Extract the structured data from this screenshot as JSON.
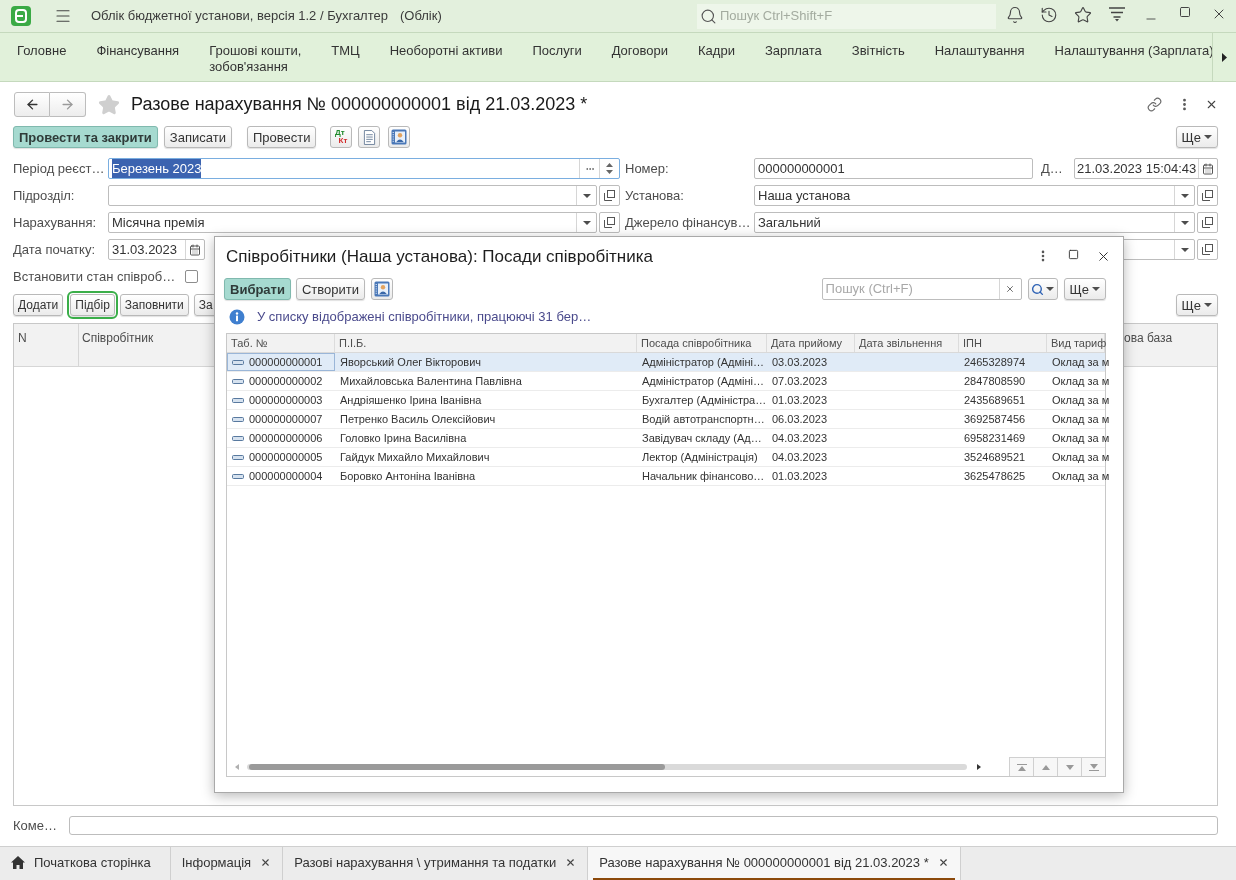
{
  "app_bar": {
    "title": "Облік бюджетної установи, версія 1.2 / Бухгалтер",
    "mode": "(Облік)",
    "search": {
      "placeholder": "Пошук Ctrl+Shift+F"
    }
  },
  "sections": [
    "Головне",
    "Фінансування",
    "Грошові кошти,\nзобов'язання",
    "ТМЦ",
    "Необоротні активи",
    "Послуги",
    "Договори",
    "Кадри",
    "Зарплата",
    "Звітність",
    "Налаштування",
    "Налаштування (Зарплата)"
  ],
  "document": {
    "title": "Разове нарахування № 000000000001 від 21.03.2023 *",
    "toolbar": [
      {
        "kind": "primary",
        "label": "Провести та закрити"
      },
      {
        "kind": "text",
        "label": "Записати"
      },
      {
        "kind": "text",
        "label": "Провести"
      },
      {
        "kind": "debit_credit",
        "top": "Дт",
        "bottom": "Кт"
      },
      {
        "kind": "report"
      },
      {
        "kind": "employee"
      }
    ],
    "more": "Ще",
    "fields_left": [
      {
        "kind": "period",
        "label": "Період реєст…",
        "value": "Березень 2023",
        "focused": true
      },
      {
        "kind": "select",
        "label": "Підрозділ:",
        "focused": false
      },
      {
        "kind": "select",
        "label": "Нарахування:",
        "value": "Місячна премія",
        "focused": false
      },
      {
        "kind": "date",
        "label": "Дата початку:",
        "value": "31.03.2023",
        "focused": false
      },
      {
        "kind": "checkbox",
        "label": "Встановити стан співроб…",
        "checked": false,
        "focused": false
      }
    ],
    "fields_right": [
      {
        "kind": "number",
        "label": "Номер:",
        "value": "000000000001",
        "date_label": "Д…",
        "date_value": "21.03.2023 15:04:43",
        "focused": false
      },
      {
        "kind": "select",
        "label": "Установа:",
        "value": "Наша установа",
        "focused": false
      },
      {
        "kind": "select",
        "label": "Джерело фінансув…",
        "value": "Загальний",
        "focused": false
      },
      {
        "kind": "select"
      }
    ],
    "table_actions": [
      {
        "label": "Додати",
        "focused": false
      },
      {
        "label": "Підбір",
        "focused": true
      },
      {
        "label": "Заповнити",
        "focused": false
      },
      {
        "label": "За",
        "focused": false
      }
    ],
    "table_more": "Ще",
    "table_columns": [
      "N",
      "Співробітник",
      "ова база"
    ],
    "comment": {
      "label": "Коме…"
    }
  },
  "dialog": {
    "title": "Співробітники (Наша установа): Посади співробітника",
    "toolbar": [
      {
        "kind": "primary",
        "label": "Вибрати"
      },
      {
        "kind": "text",
        "label": "Створити"
      },
      {
        "kind": "employee"
      }
    ],
    "search": {
      "placeholder": "Пошук (Ctrl+F)"
    },
    "more": "Ще",
    "info": "У списку відображені співробітники, працюючі 31 бер…",
    "columns": [
      "Таб. №",
      "П.І.Б.",
      "Посада співробітника",
      "Дата прийому",
      "Дата звільнення",
      "ІПН",
      "Вид тариф"
    ],
    "rows": [
      {
        "selected": true,
        "tab_number": "000000000001",
        "full_name": "Яворський Олег Вікторович",
        "position": "Адміністратор (Адміні…",
        "hire_date": "03.03.2023",
        "tax_id": "2465328974",
        "tariff_kind": "Оклад за м"
      },
      {
        "selected": false,
        "tab_number": "000000000002",
        "full_name": "Михайловська Валентина Павлівна",
        "position": "Адміністратор (Адміні…",
        "hire_date": "07.03.2023",
        "tax_id": "2847808590",
        "tariff_kind": "Оклад за м"
      },
      {
        "selected": false,
        "tab_number": "000000000003",
        "full_name": "Андріяшенко Ірина Іванівна",
        "position": "Бухгалтер (Адміністра…",
        "hire_date": "01.03.2023",
        "tax_id": "2435689651",
        "tariff_kind": "Оклад за м"
      },
      {
        "selected": false,
        "tab_number": "000000000007",
        "full_name": "Петренко Василь Олексійович",
        "position": "Водій автотранспортн…",
        "hire_date": "06.03.2023",
        "tax_id": "3692587456",
        "tariff_kind": "Оклад за м"
      },
      {
        "selected": false,
        "tab_number": "000000000006",
        "full_name": "Головко Ірина Василівна",
        "position": "Завідувач складу (Ад…",
        "hire_date": "04.03.2023",
        "tax_id": "6958231469",
        "tariff_kind": "Оклад за м"
      },
      {
        "selected": false,
        "tab_number": "000000000005",
        "full_name": "Гайдук Михайло Михайлович",
        "position": "Лектор (Адміністрація)",
        "hire_date": "04.03.2023",
        "tax_id": "3524689521",
        "tariff_kind": "Оклад за м"
      },
      {
        "selected": false,
        "tab_number": "000000000004",
        "full_name": "Боровко Антоніна Іванівна",
        "position": "Начальник фінансово…",
        "hire_date": "01.03.2023",
        "tax_id": "3625478625",
        "tariff_kind": "Оклад за м"
      }
    ]
  },
  "tabs": [
    {
      "kind": "home",
      "label": "Початкова сторінка",
      "selected": false,
      "closable": false
    },
    {
      "kind": "page",
      "label": "Інформація",
      "selected": false,
      "closable": true
    },
    {
      "kind": "page",
      "label": "Разові нарахування \\ утримання та податки",
      "selected": false,
      "closable": true
    },
    {
      "kind": "page",
      "label": "Разове нарахування № 000000000001 від 21.03.2023 *",
      "selected": true,
      "closable": true
    }
  ]
}
